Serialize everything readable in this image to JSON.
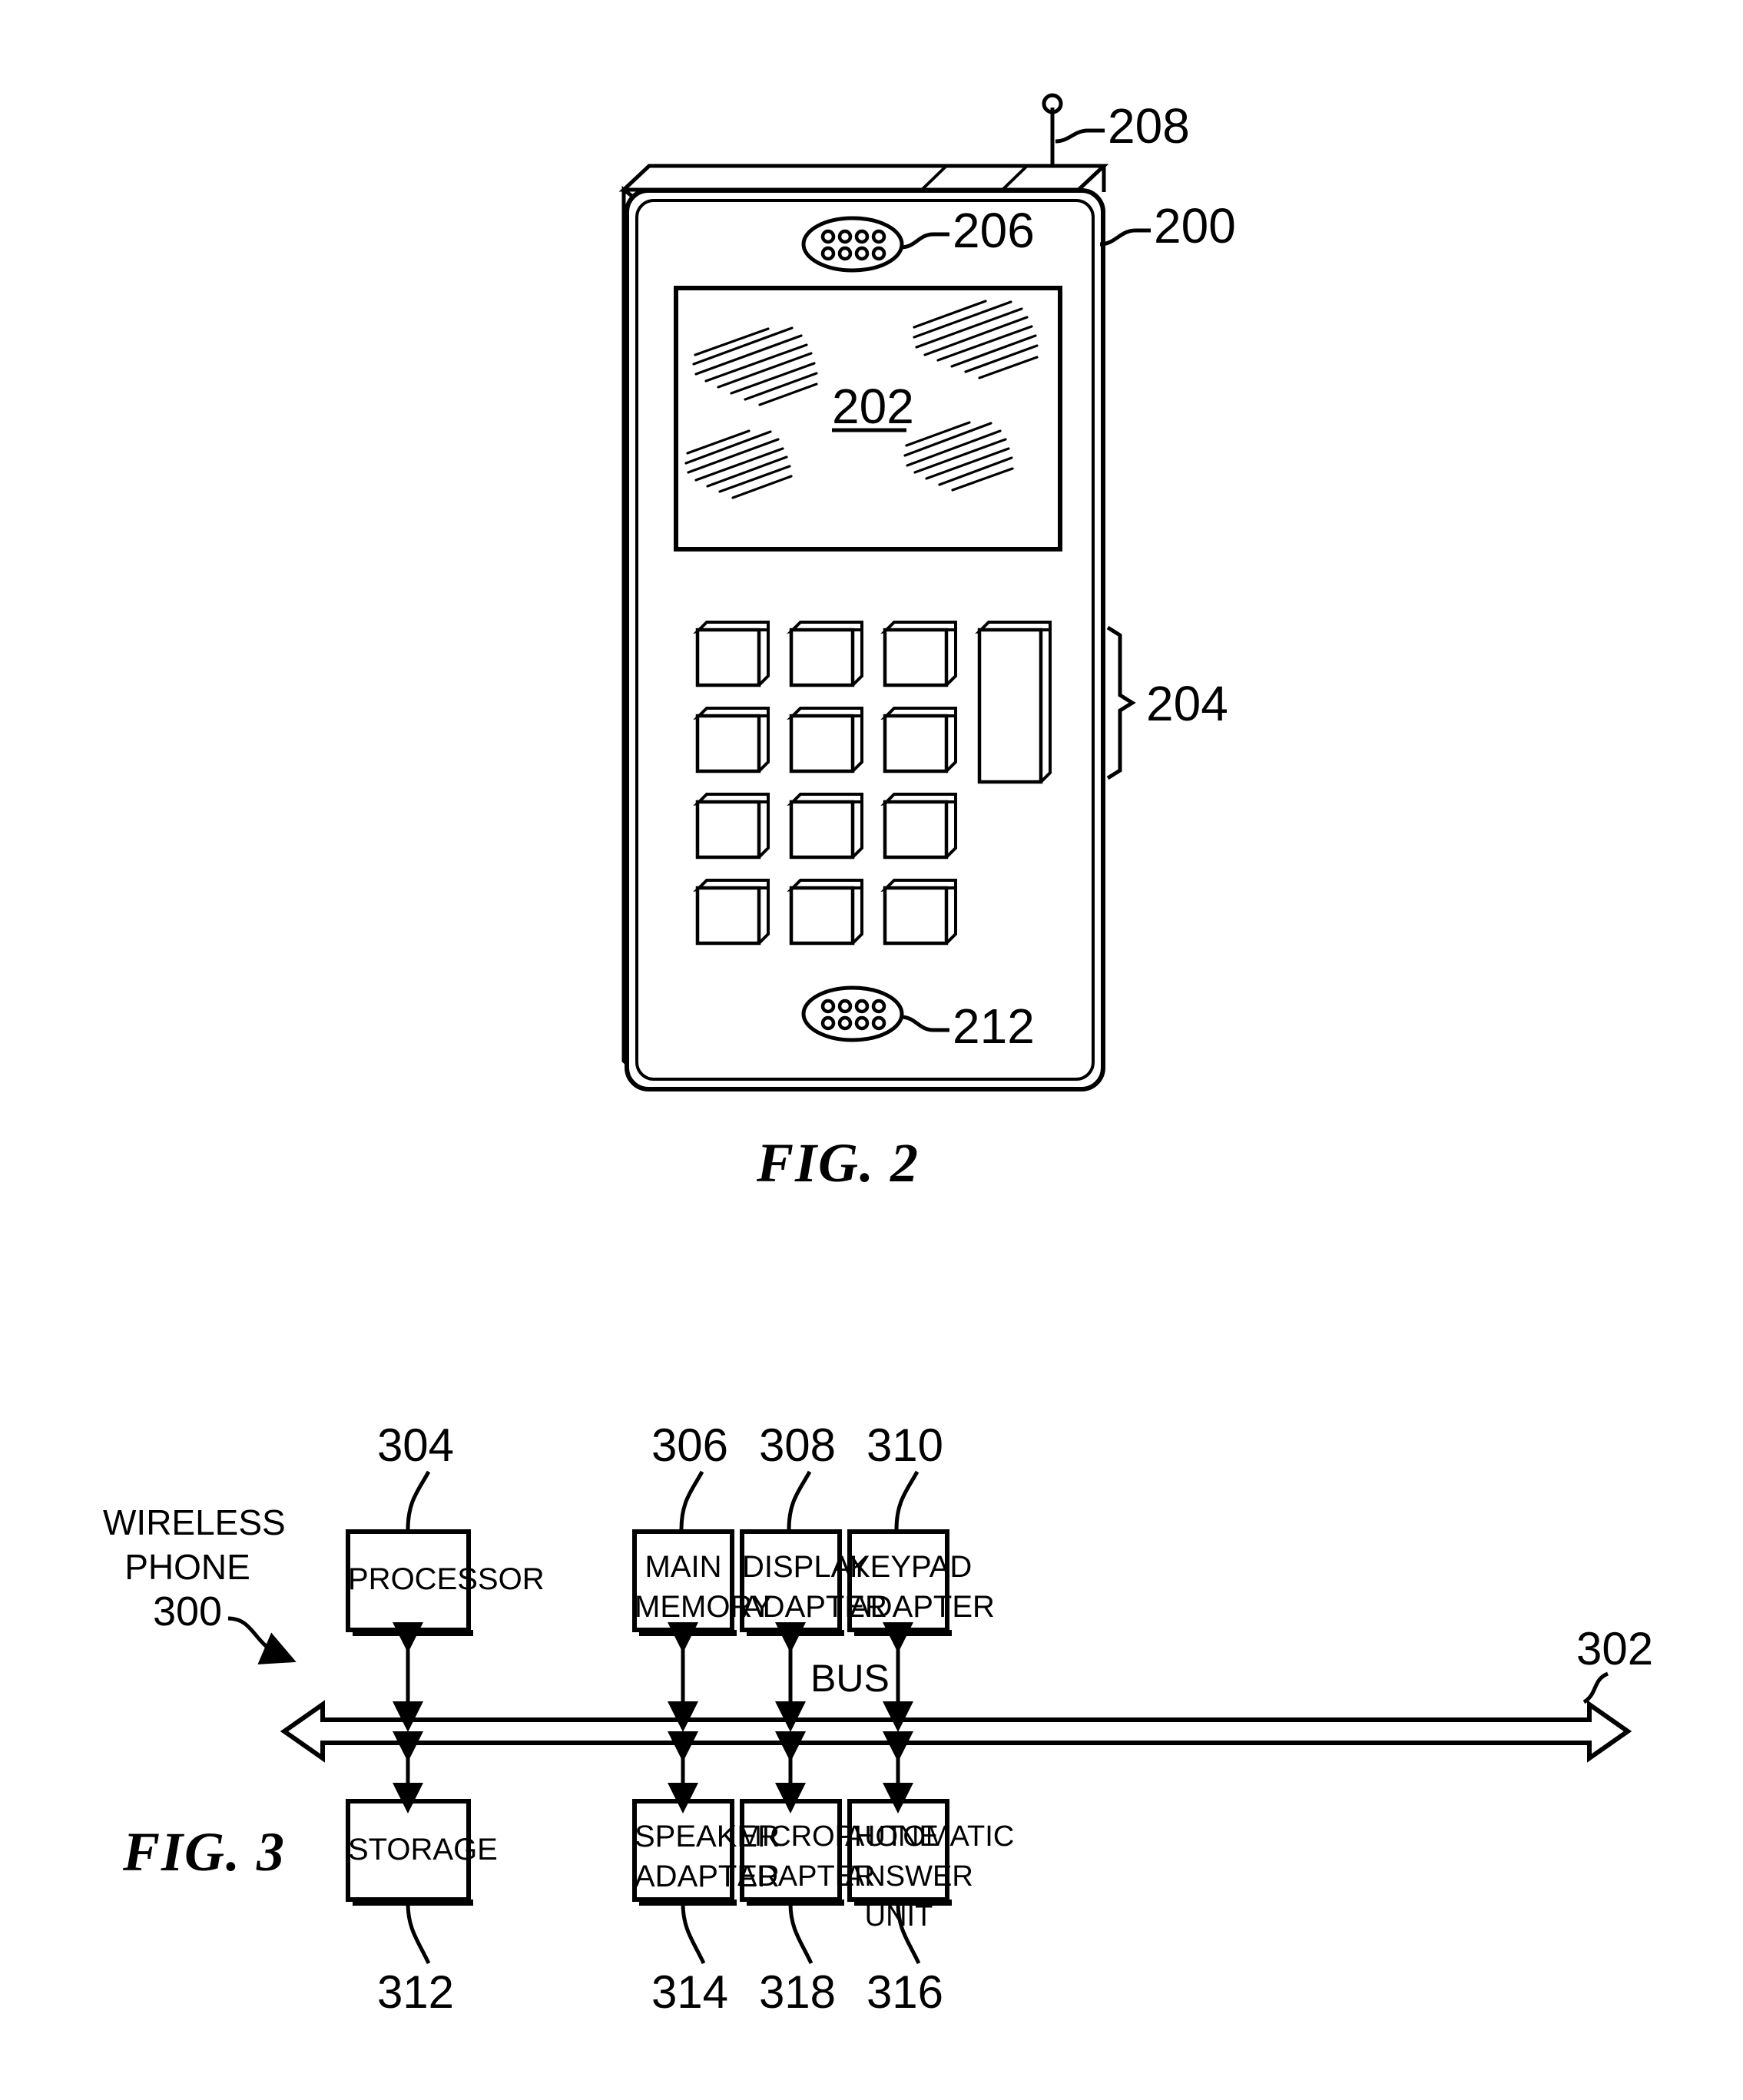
{
  "figure2": {
    "caption": "FIG. 2",
    "callouts": {
      "device": "200",
      "display": "202",
      "keypad": "204",
      "speaker": "206",
      "antenna": "208",
      "microphone": "212"
    },
    "display_label": "202",
    "keypad_keys_rows": [
      [
        "key",
        "key",
        "key"
      ],
      [
        "key",
        "key",
        "key"
      ],
      [
        "key",
        "key",
        "key"
      ],
      [
        "key",
        "key",
        "key"
      ]
    ],
    "keypad_side_key": "key-tall",
    "speaker_hole_rows": 2,
    "speaker_holes_per_row": 4,
    "microphone_hole_rows": 2,
    "microphone_holes_per_row": 4
  },
  "figure3": {
    "caption": "FIG. 3",
    "system_label_line1": "WIRELESS",
    "system_label_line2": "PHONE",
    "system_number": "300",
    "bus_label": "BUS",
    "bus_number": "302",
    "top_row": [
      {
        "lines": [
          "PROCESSOR"
        ],
        "number": "304"
      },
      {
        "lines": [
          "MAIN",
          "MEMORY"
        ],
        "number": "306"
      },
      {
        "lines": [
          "DISPLAY",
          "ADAPTER"
        ],
        "number": "308"
      },
      {
        "lines": [
          "KEYPAD",
          "ADAPTER"
        ],
        "number": "310"
      }
    ],
    "bottom_row": [
      {
        "lines": [
          "STORAGE"
        ],
        "number": "312"
      },
      {
        "lines": [
          "SPEAKER",
          "ADAPTER"
        ],
        "number": "314"
      },
      {
        "lines": [
          "MICROPHONE",
          "ADAPTER"
        ],
        "number": "318"
      },
      {
        "lines": [
          "AUTOMATIC",
          "ANSWER UNIT"
        ],
        "number": "316"
      }
    ]
  },
  "colors": {
    "ink": "#000000",
    "paper": "#ffffff"
  }
}
